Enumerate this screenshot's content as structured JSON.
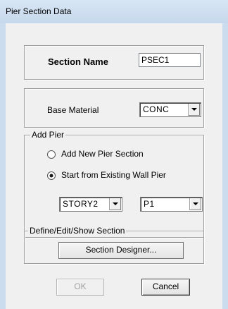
{
  "window": {
    "title": "Pier Section Data"
  },
  "section_name": {
    "label": "Section Name",
    "value": "PSEC1"
  },
  "base_material": {
    "label": "Base Material",
    "value": "CONC"
  },
  "add_pier": {
    "legend": "Add Pier",
    "options": [
      {
        "label": "Add New Pier Section",
        "selected": false
      },
      {
        "label": "Start from Existing Wall Pier",
        "selected": true
      }
    ],
    "story_value": "STORY2",
    "pier_value": "P1"
  },
  "define_section": {
    "legend": "Define/Edit/Show Section",
    "button_label": "Section Designer..."
  },
  "footer": {
    "ok_label": "OK",
    "cancel_label": "Cancel"
  }
}
